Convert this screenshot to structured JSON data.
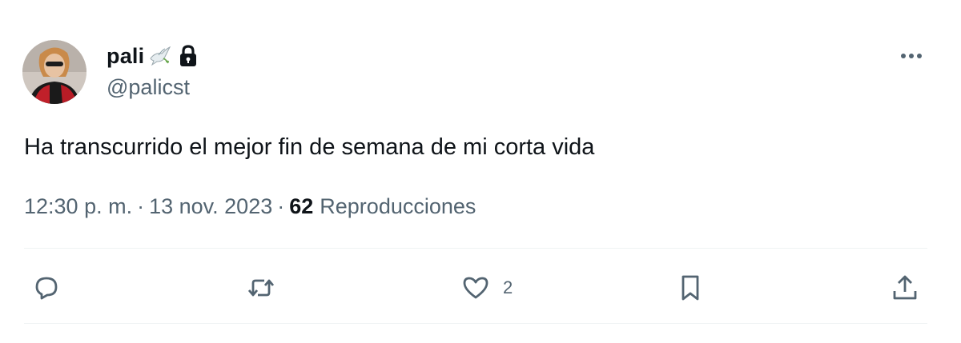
{
  "author": {
    "display_name": "pali",
    "name_emoji": "dove-icon",
    "protected_icon": "lock-icon",
    "handle": "@palicst"
  },
  "tweet": {
    "text": "Ha transcurrido el mejor fin de semana de mi corta vida",
    "time": "12:30 p. m.",
    "separator": "·",
    "date": "13 nov. 2023",
    "views_count": "62",
    "views_label": "Reproducciones"
  },
  "actions": {
    "reply_icon": "reply-icon",
    "retweet_icon": "retweet-icon",
    "like_icon": "heart-icon",
    "like_count": "2",
    "bookmark_icon": "bookmark-icon",
    "share_icon": "share-icon"
  },
  "colors": {
    "text_primary": "#0f1419",
    "text_secondary": "#536471",
    "divider": "#eff3f4"
  }
}
